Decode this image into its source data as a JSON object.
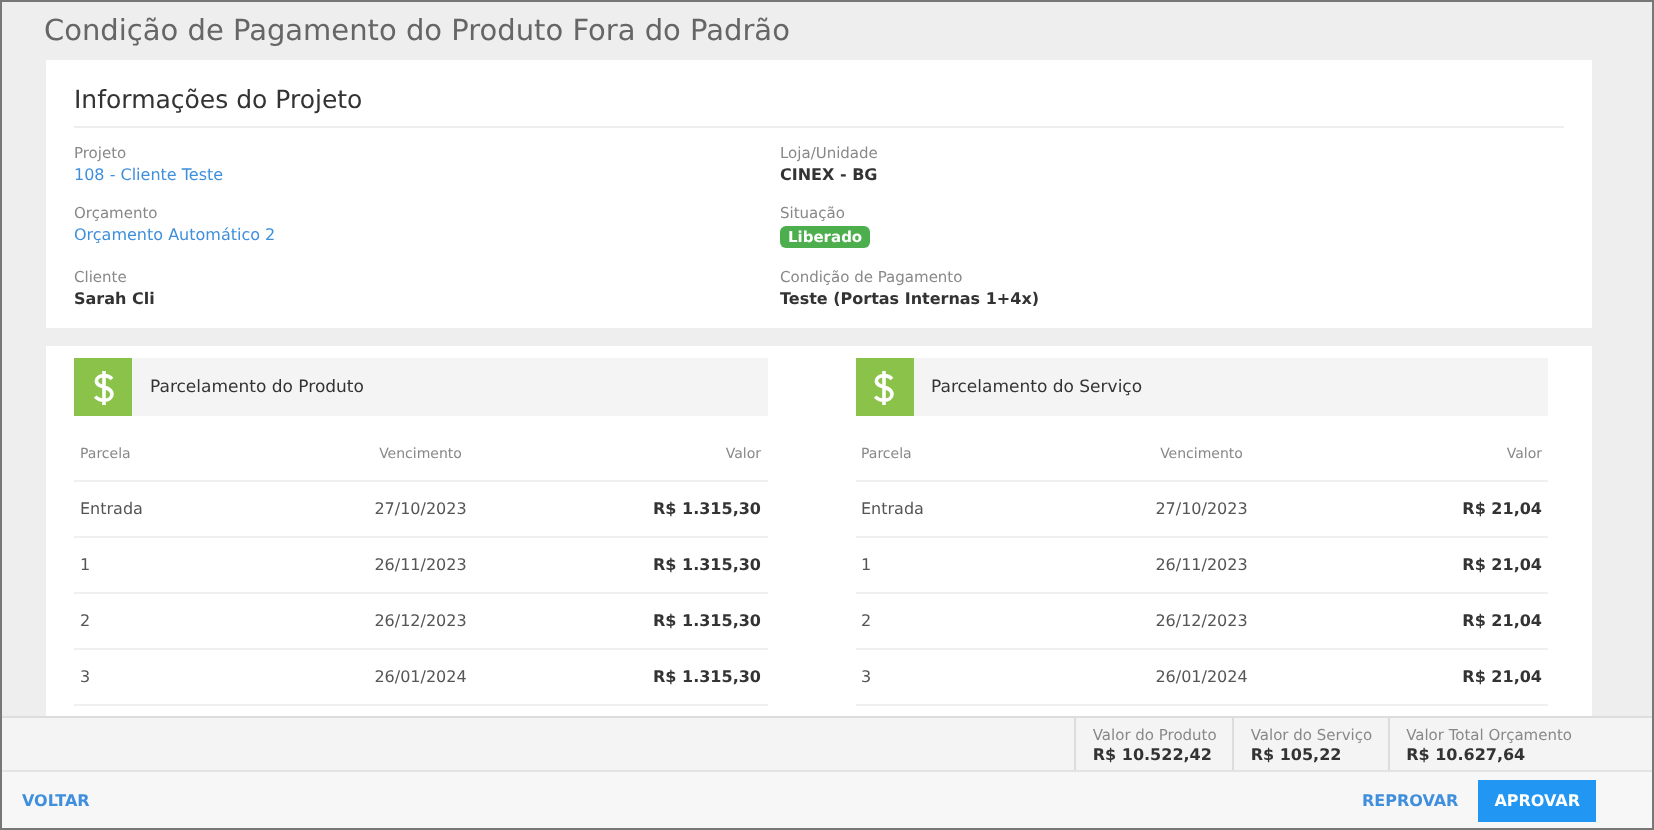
{
  "window": {
    "title": "Condição de Pagamento do Produto Fora do Padrão"
  },
  "project_info": {
    "title": "Informações do Projeto",
    "fields": [
      {
        "label": "Projeto",
        "value": "108 - Cliente Teste",
        "kind": "link"
      },
      {
        "label": "Loja/Unidade",
        "value": "CINEX - BG",
        "kind": "text"
      },
      {
        "label": "Orçamento",
        "value": "Orçamento Automático 2",
        "kind": "link"
      },
      {
        "label": "Situação",
        "value": "Liberado",
        "kind": "badge",
        "color": "#4cae4c"
      },
      {
        "label": "Cliente",
        "value": "Sarah Cli",
        "kind": "text"
      },
      {
        "label": "Condição de Pagamento",
        "value": "Teste (Portas Internas 1+4x)",
        "kind": "text"
      }
    ]
  },
  "installments": [
    {
      "title": "Parcelamento do Produto",
      "columns": [
        "Parcela",
        "Vencimento",
        "Valor"
      ],
      "rows": [
        [
          "Entrada",
          "27/10/2023",
          "R$ 1.315,30"
        ],
        [
          "1",
          "26/11/2023",
          "R$ 1.315,30"
        ],
        [
          "2",
          "26/12/2023",
          "R$ 1.315,30"
        ],
        [
          "3",
          "26/01/2024",
          "R$ 1.315,30"
        ]
      ]
    },
    {
      "title": "Parcelamento do Serviço",
      "columns": [
        "Parcela",
        "Vencimento",
        "Valor"
      ],
      "rows": [
        [
          "Entrada",
          "27/10/2023",
          "R$ 21,04"
        ],
        [
          "1",
          "26/11/2023",
          "R$ 21,04"
        ],
        [
          "2",
          "26/12/2023",
          "R$ 21,04"
        ],
        [
          "3",
          "26/01/2024",
          "R$ 21,04"
        ]
      ]
    }
  ],
  "totals": [
    {
      "label": "Valor do Produto",
      "value": "R$ 10.522,42"
    },
    {
      "label": "Valor do Serviço",
      "value": "R$ 105,22"
    },
    {
      "label": "Valor Total Orçamento",
      "value": "R$ 10.627,64"
    }
  ],
  "actions": {
    "back": "VOLTAR",
    "reject": "REPROVAR",
    "approve": "APROVAR"
  }
}
